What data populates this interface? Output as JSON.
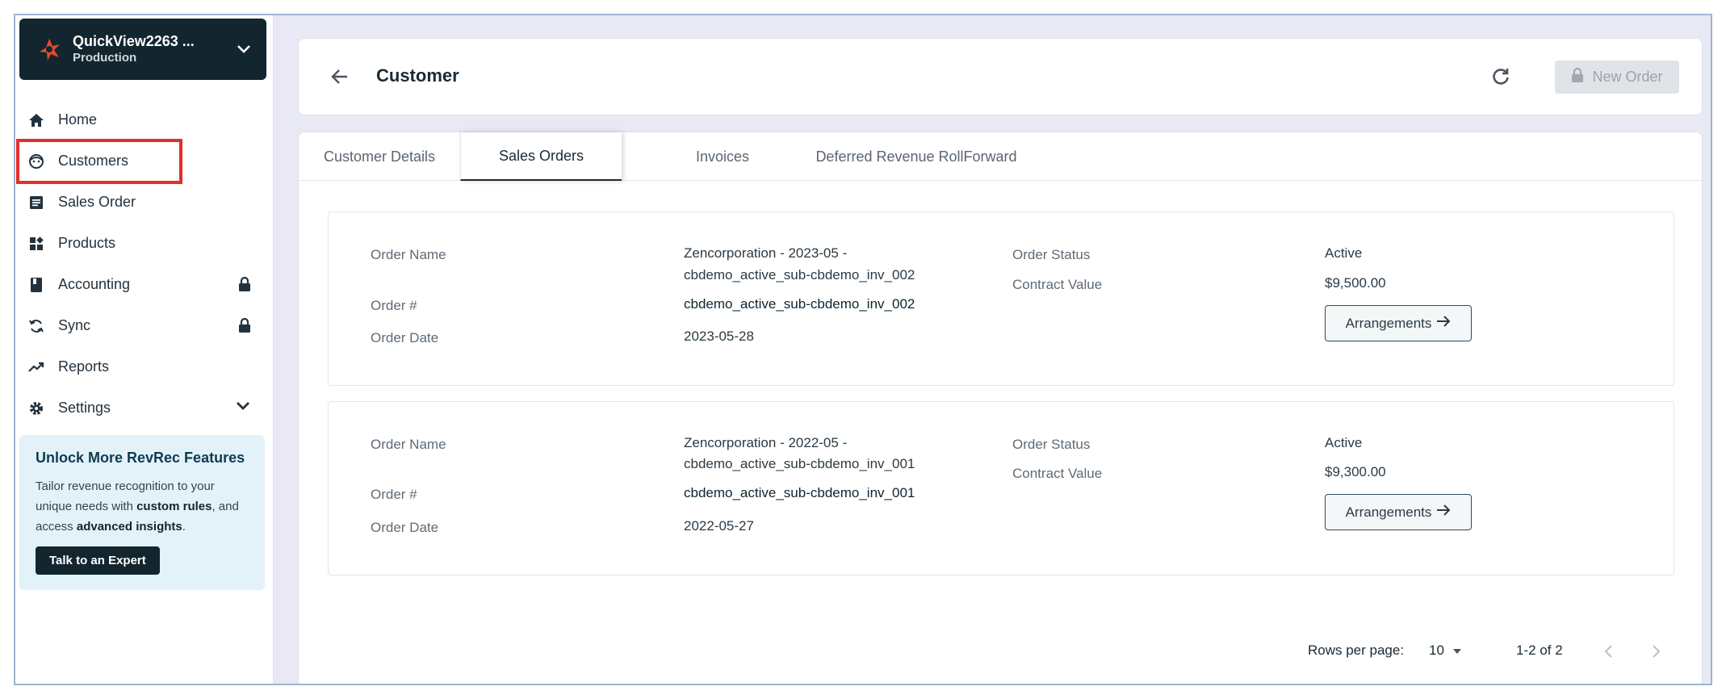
{
  "org": {
    "name": "QuickView2263 ...",
    "env": "Production"
  },
  "nav": [
    {
      "label": "Home"
    },
    {
      "label": "Customers"
    },
    {
      "label": "Sales Order"
    },
    {
      "label": "Products"
    },
    {
      "label": "Accounting"
    },
    {
      "label": "Sync"
    },
    {
      "label": "Reports"
    },
    {
      "label": "Settings"
    }
  ],
  "promo": {
    "title": "Unlock More RevRec Features",
    "body_1": "Tailor revenue recognition to your unique needs with ",
    "bold_1": "custom rules",
    "body_2": ", and access ",
    "bold_2": "advanced insights",
    "body_3": ".",
    "button": "Talk to an Expert"
  },
  "header": {
    "title": "Customer",
    "new_order": "New Order"
  },
  "tabs": [
    "Customer Details",
    "Sales Orders",
    "Invoices",
    "Deferred Revenue RollForward"
  ],
  "labels": {
    "order_name": "Order Name",
    "order_num": "Order #",
    "order_date": "Order Date",
    "order_status": "Order Status",
    "contract_value": "Contract Value",
    "arrangements": "Arrangements"
  },
  "orders": [
    {
      "name_line1": "Zencorporation - 2023-05 -",
      "name_line2": "cbdemo_active_sub-cbdemo_inv_002",
      "number": "cbdemo_active_sub-cbdemo_inv_002",
      "date": "2023-05-28",
      "status": "Active",
      "contract_value": "$9,500.00"
    },
    {
      "name_line1": "Zencorporation - 2022-05 -",
      "name_line2": "cbdemo_active_sub-cbdemo_inv_001",
      "number": "cbdemo_active_sub-cbdemo_inv_001",
      "date": "2022-05-27",
      "status": "Active",
      "contract_value": "$9,300.00"
    }
  ],
  "pagination": {
    "rows_label": "Rows per page:",
    "rows_value": "10",
    "range": "1-2 of 2"
  },
  "colors": {
    "sidebar_dark": "#13262f",
    "highlight": "#e1302c",
    "promo_bg": "#e3f2f9",
    "page_bg": "#e8e9f4"
  }
}
